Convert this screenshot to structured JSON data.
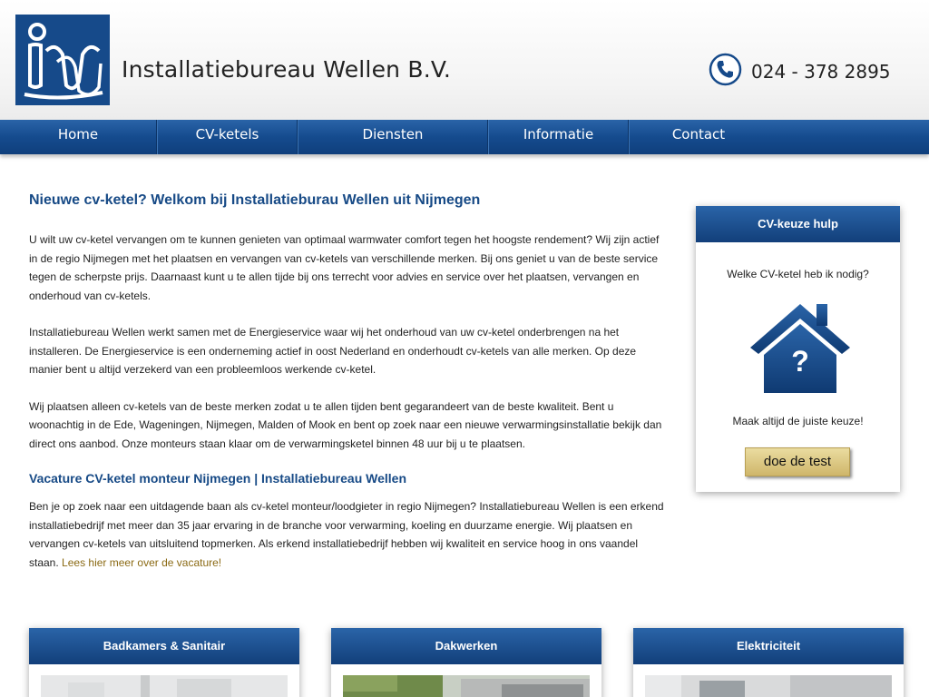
{
  "header": {
    "site_title": "Installatiebureau Wellen B.V.",
    "phone": "024 - 378 2895",
    "logo_text": "iww"
  },
  "nav": {
    "items": [
      "Home",
      "CV-ketels",
      "Diensten",
      "Informatie",
      "Contact"
    ]
  },
  "main": {
    "heading": "Nieuwe cv-ketel? Welkom bij Installatieburau Wellen uit Nijmegen",
    "paragraphs": [
      "U wilt uw cv-ketel vervangen om te kunnen genieten van optimaal warmwater comfort tegen het hoogste rendement? Wij zijn actief in de regio Nijmegen met het plaatsen en vervangen van cv-ketels van verschillende merken. Bij ons geniet u van de beste service tegen de scherpste prijs. Daarnaast kunt u te allen tijde bij ons terrecht voor advies en service over het plaatsen, vervangen en onderhoud van cv-ketels.",
      "Installatiebureau Wellen werkt samen met de Energieservice waar wij het onderhoud van uw cv-ketel onderbrengen na het installeren. De Energieservice is een onderneming actief in oost Nederland en onderhoudt cv-ketels van alle merken. Op deze manier bent u altijd verzekerd van een probleemloos werkende cv-ketel.",
      "Wij plaatsen alleen cv-ketels van de beste merken zodat u te allen tijden bent gegarandeert van de beste kwaliteit. Bent u woonachtig in de Ede, Wageningen, Nijmegen, Malden of Mook en bent op zoek naar een nieuwe verwarmingsinstallatie bekijk dan direct ons aanbod. Onze monteurs staan klaar om de verwarmingsketel binnen 48 uur bij u te plaatsen."
    ],
    "vacancy_heading": "Vacature CV-ketel monteur Nijmegen | Installatiebureau Wellen",
    "vacancy_text": "Ben je op zoek naar een uitdagende baan als cv-ketel monteur/loodgieter in regio Nijmegen? Installatiebureau Wellen is een erkend installatiebedrijf met meer dan 35 jaar ervaring in de branche voor verwarming, koeling en duurzame energie. Wij plaatsen en vervangen cv-ketels van uitsluitend topmerken. Als erkend installatiebedrijf hebben wij kwaliteit en service hoog in ons vaandel staan.",
    "vacancy_link": "Lees hier meer over de vacature!"
  },
  "widget": {
    "title": "CV-keuze hulp",
    "question": "Welke CV-ketel heb ik nodig?",
    "house_symbol": "?",
    "note": "Maak altijd de juiste keuze!",
    "button_label": "doe de test"
  },
  "cards": [
    {
      "title": "Badkamers & Sanitair"
    },
    {
      "title": "Dakwerken"
    },
    {
      "title": "Elektriciteit"
    }
  ],
  "colors": {
    "brand_blue": "#164a8a",
    "heading_blue": "#174a86",
    "link_gold": "#8b6a14",
    "button_gold": "#d9c47c"
  }
}
